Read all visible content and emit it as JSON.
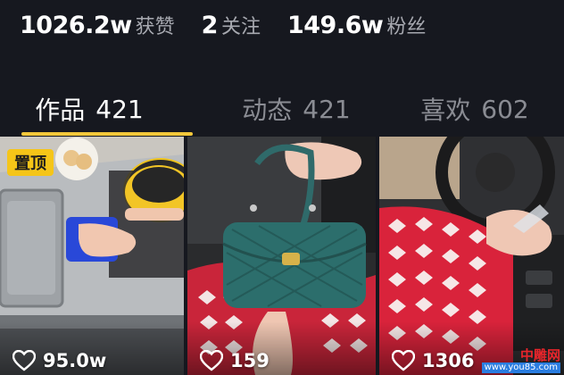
{
  "stats": [
    {
      "value": "1026.2w",
      "label": "获赞"
    },
    {
      "value": "2",
      "label": "关注"
    },
    {
      "value": "149.6w",
      "label": "粉丝"
    }
  ],
  "tabs": [
    {
      "label": "作品",
      "count": "421",
      "active": true
    },
    {
      "label": "动态",
      "count": "421",
      "active": false
    },
    {
      "label": "喜欢",
      "count": "602",
      "active": false
    }
  ],
  "videos": [
    {
      "likes": "95.0w",
      "pinned_label": "置顶"
    },
    {
      "likes": "159"
    },
    {
      "likes": "1306"
    }
  ],
  "watermark": {
    "brand": "中雕网",
    "domain": "www.you85.com"
  },
  "colors": {
    "background": "#16181f",
    "tab_indicator": "#f3c73a",
    "pin_badge": "#f5c518"
  }
}
